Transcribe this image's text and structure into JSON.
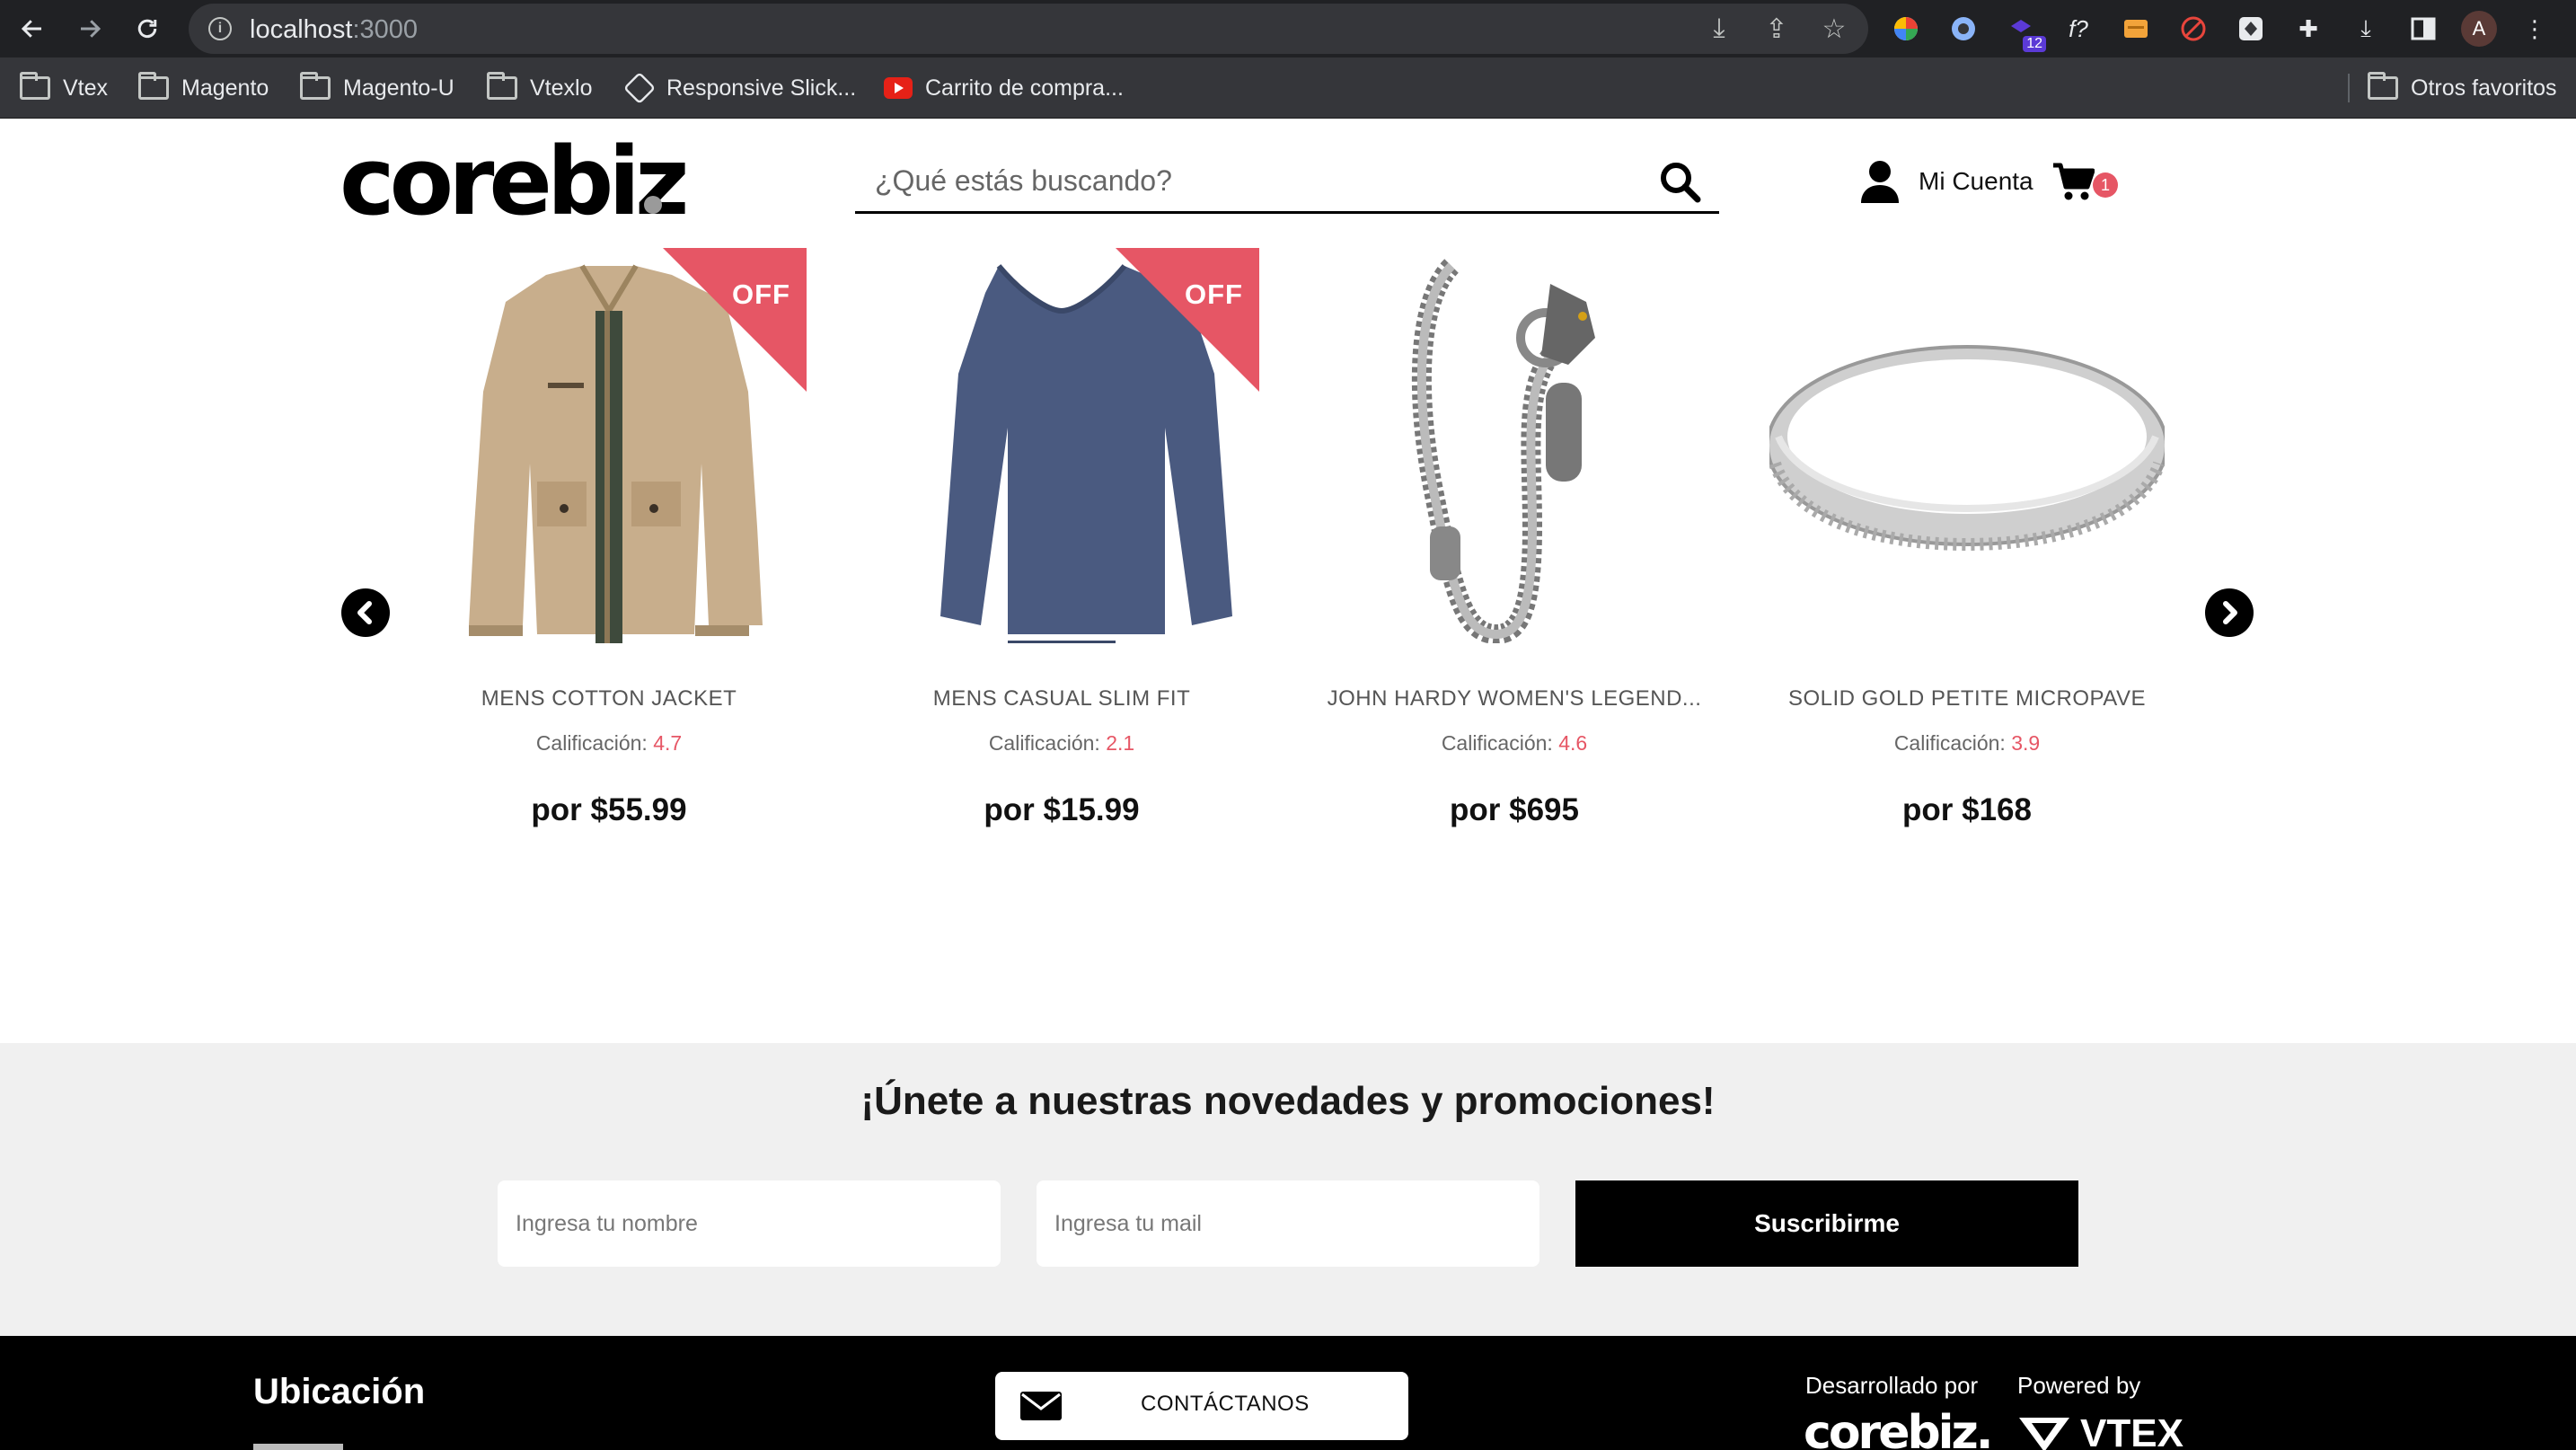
{
  "browser": {
    "url_host": "localhost",
    "url_port": ":3000",
    "ext_badge": "12",
    "ext_font": "f?",
    "avatar_letter": "A"
  },
  "bookmarks": {
    "items": [
      "Vtex",
      "Magento",
      "Magento-U",
      "Vtexlo",
      "Responsive Slick...",
      "Carrito de compra..."
    ],
    "other": "Otros favoritos"
  },
  "header": {
    "logo": "corebiz",
    "search_placeholder": "¿Qué estás buscando?",
    "account_label": "Mi Cuenta",
    "cart_count": "1"
  },
  "products": [
    {
      "name": "MENS COTTON JACKET",
      "rating_label": "Calificación:",
      "rating": "4.7",
      "price": "por $55.99",
      "off": "OFF"
    },
    {
      "name": "MENS CASUAL SLIM FIT",
      "rating_label": "Calificación:",
      "rating": "2.1",
      "price": "por $15.99",
      "off": "OFF"
    },
    {
      "name": "JOHN HARDY WOMEN'S LEGEND...",
      "rating_label": "Calificación:",
      "rating": "4.6",
      "price": "por $695",
      "off": ""
    },
    {
      "name": "SOLID GOLD PETITE MICROPAVE",
      "rating_label": "Calificación:",
      "rating": "3.9",
      "price": "por $168",
      "off": ""
    }
  ],
  "newsletter": {
    "title": "¡Únete a nuestras novedades y promociones!",
    "name_placeholder": "Ingresa tu nombre",
    "email_placeholder": "Ingresa tu mail",
    "button": "Suscribirme"
  },
  "footer": {
    "location_title": "Ubicación",
    "contact_button": "CONTÁCTANOS",
    "developed_by": "Desarrollado por",
    "developed_logo": "corebiz.",
    "powered_by": "Powered by",
    "powered_logo": "VTEX"
  },
  "colors": {
    "accent": "#e65665",
    "newsletter_bg": "#f0f0f0",
    "footer_bg": "#000000"
  }
}
